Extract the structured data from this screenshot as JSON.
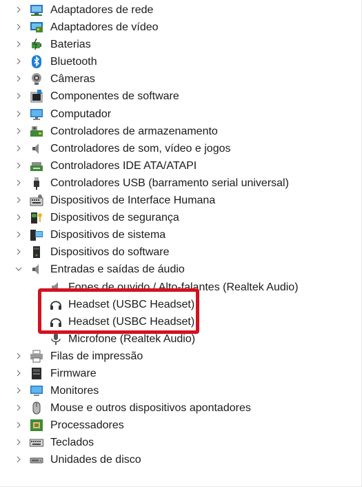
{
  "device_manager": {
    "items": [
      {
        "label": "Adaptadores de rede",
        "icon": "network-adapter-icon",
        "expanded": false
      },
      {
        "label": "Adaptadores de vídeo",
        "icon": "display-adapter-icon",
        "expanded": false
      },
      {
        "label": "Baterias",
        "icon": "battery-icon",
        "expanded": false
      },
      {
        "label": "Bluetooth",
        "icon": "bluetooth-icon",
        "expanded": false
      },
      {
        "label": "Câmeras",
        "icon": "camera-icon",
        "expanded": false
      },
      {
        "label": "Componentes de software",
        "icon": "software-component-icon",
        "expanded": false
      },
      {
        "label": "Computador",
        "icon": "computer-icon",
        "expanded": false
      },
      {
        "label": "Controladores de armazenamento",
        "icon": "storage-controller-icon",
        "expanded": false
      },
      {
        "label": "Controladores de som, vídeo e jogos",
        "icon": "speaker-icon",
        "expanded": false
      },
      {
        "label": "Controladores IDE ATA/ATAPI",
        "icon": "ide-controller-icon",
        "expanded": false
      },
      {
        "label": "Controladores USB (barramento serial universal)",
        "icon": "usb-icon",
        "expanded": false
      },
      {
        "label": "Dispositivos de Interface Humana",
        "icon": "hid-icon",
        "expanded": false
      },
      {
        "label": "Dispositivos de segurança",
        "icon": "security-device-icon",
        "expanded": false
      },
      {
        "label": "Dispositivos de sistema",
        "icon": "system-device-icon",
        "expanded": false
      },
      {
        "label": "Dispositivos do software",
        "icon": "software-device-icon",
        "expanded": false
      },
      {
        "label": "Entradas e saídas de áudio",
        "icon": "audio-io-icon",
        "expanded": true
      }
    ],
    "audio_children": [
      {
        "label": "Fones de ouvido / Alto-falantes (Realtek Audio)",
        "icon": "speaker-icon"
      },
      {
        "label": "Headset (USBC Headset)",
        "icon": "headset-icon"
      },
      {
        "label": "Headset (USBC Headset)",
        "icon": "headset-icon"
      },
      {
        "label": "Microfone (Realtek Audio)",
        "icon": "microphone-icon"
      }
    ],
    "items_after": [
      {
        "label": "Filas de impressão",
        "icon": "printer-icon",
        "expanded": false
      },
      {
        "label": "Firmware",
        "icon": "firmware-icon",
        "expanded": false
      },
      {
        "label": "Monitores",
        "icon": "monitor-icon",
        "expanded": false
      },
      {
        "label": "Mouse e outros dispositivos apontadores",
        "icon": "mouse-icon",
        "expanded": false
      },
      {
        "label": "Processadores",
        "icon": "processor-icon",
        "expanded": false
      },
      {
        "label": "Teclados",
        "icon": "keyboard-icon",
        "expanded": false
      },
      {
        "label": "Unidades de disco",
        "icon": "disk-drive-icon",
        "expanded": false
      }
    ],
    "highlight_color": "#d2121f"
  }
}
